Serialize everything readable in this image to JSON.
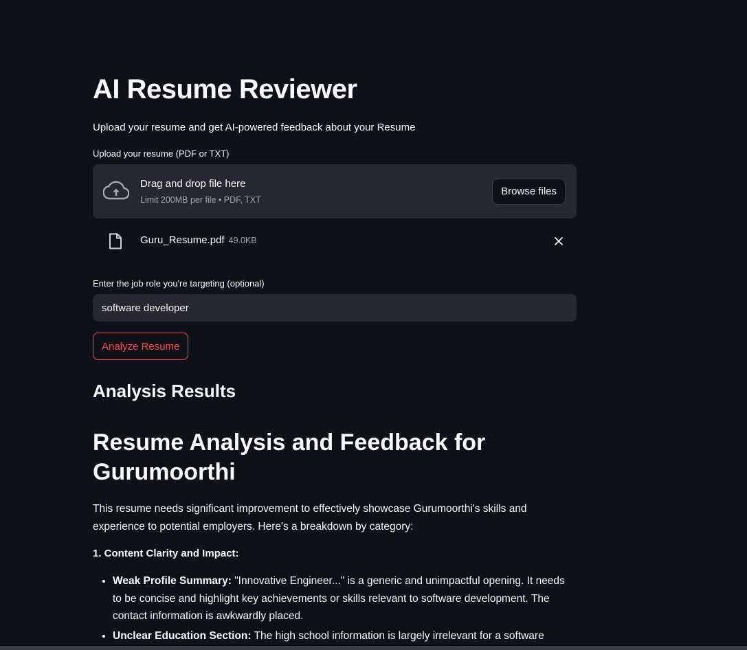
{
  "app": {
    "title": "AI Resume Reviewer",
    "subtitle": "Upload your resume and get AI-powered feedback about your Resume"
  },
  "uploader": {
    "label": "Upload your resume (PDF or TXT)",
    "drag_text": "Drag and drop file here",
    "limit_text": "Limit 200MB per file • PDF, TXT",
    "browse_label": "Browse files",
    "icon": "cloud-upload-icon"
  },
  "uploaded_file": {
    "name": "Guru_Resume.pdf",
    "size": "49.0KB",
    "icon": "file-icon"
  },
  "job_role": {
    "label": "Enter the job role you're targeting (optional)",
    "value": "software developer"
  },
  "analyze_button": {
    "label": "Analyze Resume"
  },
  "results": {
    "heading": "Analysis Results",
    "title": "Resume Analysis and Feedback for Gurumoorthi",
    "intro": "This resume needs significant improvement to effectively showcase Gurumoorthi's skills and experience to potential employers. Here's a breakdown by category:",
    "section_1": "1. Content Clarity and Impact:",
    "items": [
      {
        "title": "Weak Profile Summary:",
        "text": " \"Innovative Engineer...\" is a generic and unimpactful opening. It needs to be concise and highlight key achievements or skills relevant to software development. The contact information is awkwardly placed."
      },
      {
        "title": "Unclear Education Section:",
        "text": " The high school information is largely irrelevant for a software developer role. Focus on the college degree and relevant coursework. The minor degree section should be"
      }
    ]
  },
  "colors": {
    "background": "#0e1117",
    "widget": "#262730",
    "accent": "#ff4b4b",
    "text": "#fafafa",
    "muted": "#a3a8b4"
  }
}
